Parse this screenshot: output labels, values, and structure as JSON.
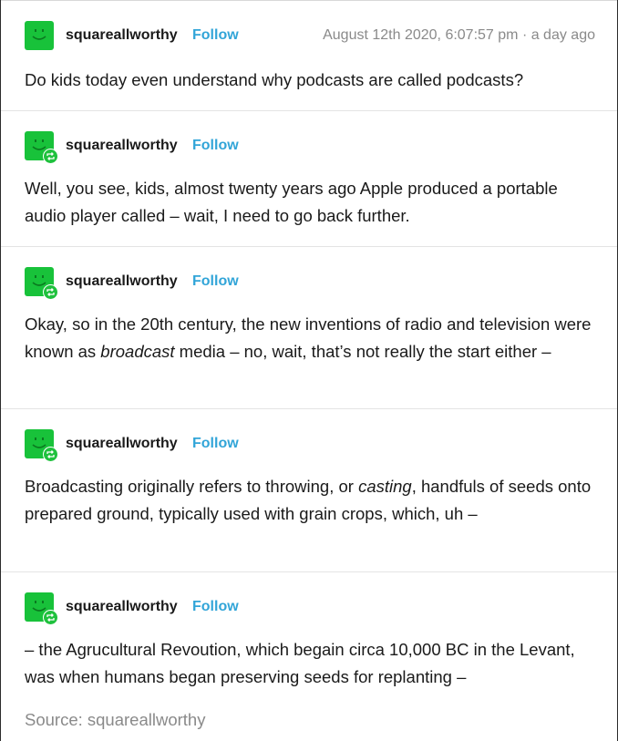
{
  "colors": {
    "avatar_green": "#18c23a",
    "follow_blue": "#32a5d8",
    "meta_gray": "#8a8a8a"
  },
  "posts": [
    {
      "username": "squareallworthy",
      "follow_label": "Follow",
      "timestamp": "August 12th 2020, 6:07:57 pm · a day ago",
      "is_reblog": false,
      "text": "Do kids today even understand why podcasts are called podcasts?"
    },
    {
      "username": "squareallworthy",
      "follow_label": "Follow",
      "is_reblog": true,
      "text": "Well, you see, kids, almost twenty years ago Apple produced a portable audio player called – wait, I need to go back further."
    },
    {
      "username": "squareallworthy",
      "follow_label": "Follow",
      "is_reblog": true,
      "text_before": "Okay, so in the 20th century, the new inventions of radio and television were known as ",
      "text_em": "broadcast",
      "text_after": " media – no, wait, that’s not really the start either –"
    },
    {
      "username": "squareallworthy",
      "follow_label": "Follow",
      "is_reblog": true,
      "text_before": "Broadcasting originally refers to throwing, or ",
      "text_em": "casting",
      "text_after": ", handfuls of seeds onto prepared ground, typically used with grain crops, which, uh –"
    },
    {
      "username": "squareallworthy",
      "follow_label": "Follow",
      "is_reblog": true,
      "text": "– the Agrucultural Revoution, which begain circa 10,000 BC in the Levant, was when humans began preserving seeds for replanting –"
    }
  ],
  "source": "Source: squareallworthy",
  "icons": {
    "avatar": "smiley-face-icon",
    "reblog": "reblog-icon"
  }
}
